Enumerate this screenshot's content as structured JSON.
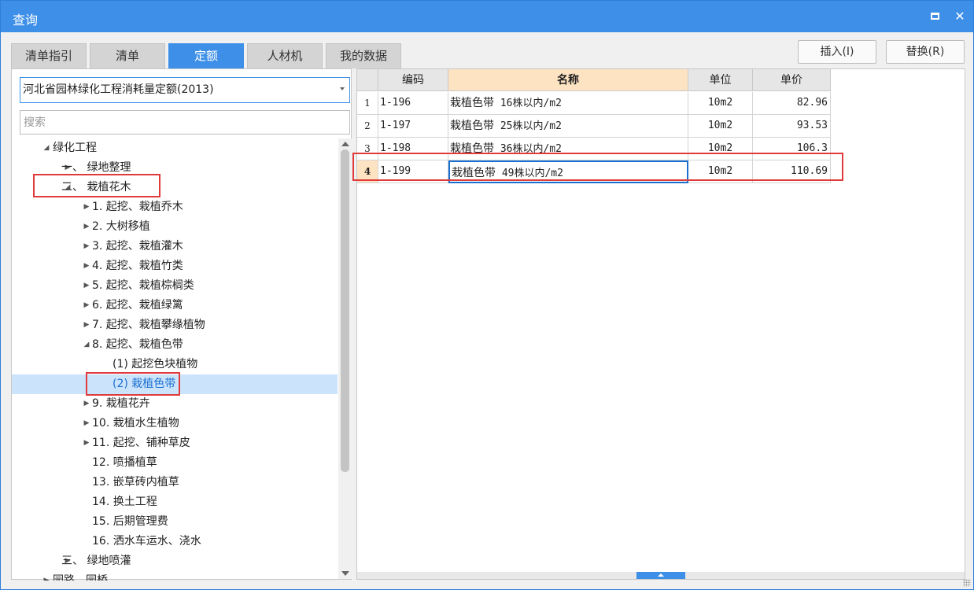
{
  "window": {
    "title": "查询"
  },
  "tabs": [
    {
      "label": "清单指引",
      "active": false
    },
    {
      "label": "清单",
      "active": false
    },
    {
      "label": "定额",
      "active": true
    },
    {
      "label": "人材机",
      "active": false
    },
    {
      "label": "我的数据",
      "active": false
    }
  ],
  "buttons": {
    "insert": "插入(I)",
    "replace": "替换(R)"
  },
  "quota_select": {
    "value": "河北省园林绿化工程消耗量定额(2013)"
  },
  "search": {
    "placeholder": "搜索"
  },
  "tree": [
    {
      "label": "绿化工程",
      "level": 0,
      "state": "expanded"
    },
    {
      "label": "一、 绿地整理",
      "level": 1,
      "state": "collapsed"
    },
    {
      "label": "二、 栽植花木",
      "level": 1,
      "state": "expanded",
      "highlighted": true
    },
    {
      "label": "1. 起挖、栽植乔木",
      "level": 2,
      "state": "collapsed"
    },
    {
      "label": "2. 大树移植",
      "level": 2,
      "state": "collapsed"
    },
    {
      "label": "3. 起挖、栽植灌木",
      "level": 2,
      "state": "collapsed"
    },
    {
      "label": "4. 起挖、栽植竹类",
      "level": 2,
      "state": "collapsed"
    },
    {
      "label": "5. 起挖、栽植棕榈类",
      "level": 2,
      "state": "collapsed"
    },
    {
      "label": "6. 起挖、栽植绿篱",
      "level": 2,
      "state": "collapsed"
    },
    {
      "label": "7. 起挖、栽植攀缘植物",
      "level": 2,
      "state": "collapsed"
    },
    {
      "label": "8. 起挖、栽植色带",
      "level": 2,
      "state": "expanded"
    },
    {
      "label": "(1) 起挖色块植物",
      "level": 3,
      "state": "leaf"
    },
    {
      "label": "(2) 栽植色带",
      "level": 3,
      "state": "leaf",
      "selected": true,
      "highlighted": true
    },
    {
      "label": "9. 栽植花卉",
      "level": 2,
      "state": "collapsed"
    },
    {
      "label": "10. 栽植水生植物",
      "level": 2,
      "state": "collapsed"
    },
    {
      "label": "11. 起挖、铺种草皮",
      "level": 2,
      "state": "collapsed"
    },
    {
      "label": "12. 喷播植草",
      "level": 2,
      "state": "leaf"
    },
    {
      "label": "13. 嵌草砖内植草",
      "level": 2,
      "state": "leaf"
    },
    {
      "label": "14. 换土工程",
      "level": 2,
      "state": "leaf"
    },
    {
      "label": "15. 后期管理费",
      "level": 2,
      "state": "leaf"
    },
    {
      "label": "16. 洒水车运水、浇水",
      "level": 2,
      "state": "leaf"
    },
    {
      "label": "三、 绿地喷灌",
      "level": 1,
      "state": "collapsed"
    },
    {
      "label": "园路、园桥",
      "level": 0,
      "state": "collapsed"
    }
  ],
  "table": {
    "columns": [
      "编码",
      "名称",
      "单位",
      "单价"
    ],
    "rows": [
      {
        "num": "1",
        "code": "1-196",
        "name_cn": "栽植色带",
        "name_rest": " 16株以内/m2",
        "unit": "10m2",
        "price": "82.96"
      },
      {
        "num": "2",
        "code": "1-197",
        "name_cn": "栽植色带",
        "name_rest": " 25株以内/m2",
        "unit": "10m2",
        "price": "93.53"
      },
      {
        "num": "3",
        "code": "1-198",
        "name_cn": "栽植色带",
        "name_rest": " 36株以内/m2",
        "unit": "10m2",
        "price": "106.3"
      },
      {
        "num": "4",
        "code": "1-199",
        "name_cn": "栽植色带",
        "name_rest": " 49株以内/m2",
        "unit": "10m2",
        "price": "110.69",
        "current": true
      }
    ]
  },
  "colors": {
    "accent": "#3d8fe8",
    "highlight_box": "#e03a3a",
    "header_active": "#fde3c2",
    "selected_row": "#cce4fb"
  }
}
